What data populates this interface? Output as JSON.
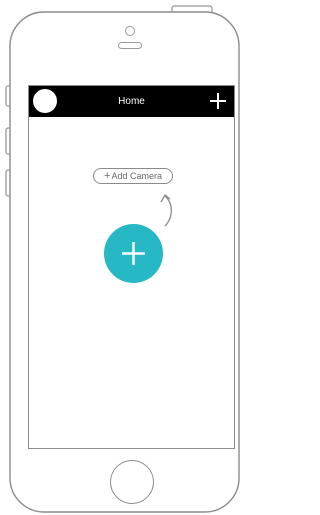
{
  "device": {
    "frame_color": "#8c8c8c",
    "earpiece_icon": "earpiece-icon",
    "camera_icon": "front-camera-icon",
    "home_button_icon": "home-button-icon"
  },
  "navbar": {
    "title": "Home",
    "background": "#000000",
    "avatar_icon": "profile-avatar-icon",
    "add_icon": "plus-icon"
  },
  "main": {
    "add_camera": {
      "plus": "+",
      "label": "Add Camera",
      "icon": "plus-icon"
    },
    "hint_arrow_icon": "curved-arrow-up-icon",
    "fab": {
      "icon": "plus-icon",
      "color": "#26b8c4"
    }
  }
}
